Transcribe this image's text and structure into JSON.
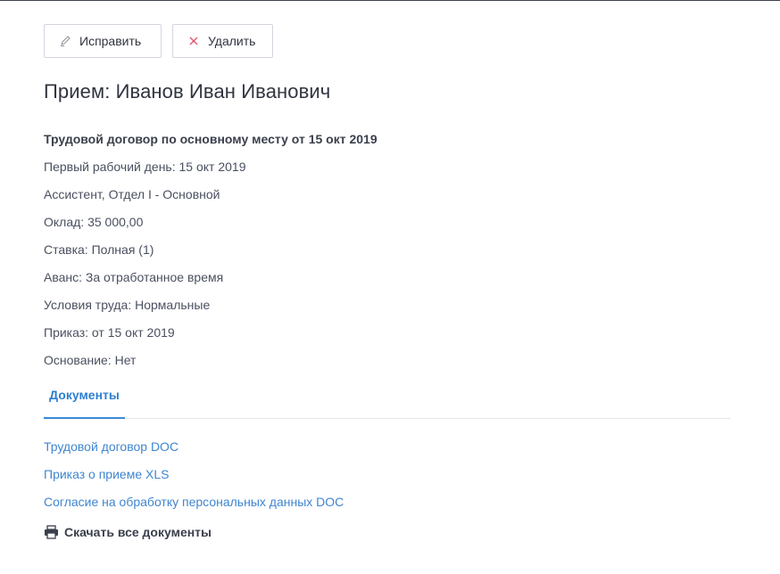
{
  "toolbar": {
    "edit_label": "Исправить",
    "delete_label": "Удалить",
    "edit_icon": "pencil-icon",
    "delete_icon": "close-icon",
    "delete_icon_color": "#e0556a"
  },
  "page_title": "Прием: Иванов Иван Иванович",
  "details": {
    "contract": "Трудовой договор по основному месту от 15 окт 2019",
    "first_day": "Первый рабочий день: 15 окт 2019",
    "position": "Ассистент, Отдел I - Основной",
    "salary": "Оклад: 35 000,00",
    "rate": "Ставка: Полная (1)",
    "advance": "Аванс: За отработанное время",
    "conditions": "Условия труда: Нормальные",
    "order": "Приказ: от 15 окт 2019",
    "basis": "Основание: Нет"
  },
  "tabs": [
    {
      "label": "Документы",
      "active": true
    }
  ],
  "documents": [
    "Трудовой договор DOC",
    "Приказ о приеме XLS",
    "Согласие на обработку персональных данных DOC"
  ],
  "download_all": {
    "label": "Скачать все документы",
    "icon": "printer-icon"
  },
  "colors": {
    "accent": "#3a8ad8",
    "link": "#3f86cf",
    "text": "#3c4150"
  }
}
